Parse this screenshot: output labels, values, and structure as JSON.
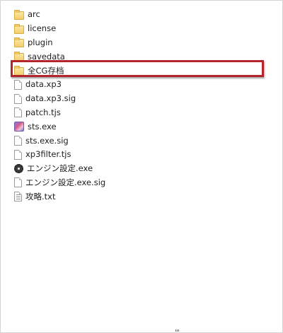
{
  "files": [
    {
      "name": "arc",
      "icon": "folder-icon"
    },
    {
      "name": "license",
      "icon": "folder-icon"
    },
    {
      "name": "plugin",
      "icon": "folder-icon"
    },
    {
      "name": "savedata",
      "icon": "folder-icon"
    },
    {
      "name": "全CG存档",
      "icon": "folder-icon",
      "highlighted": true
    },
    {
      "name": "data.xp3",
      "icon": "document-icon"
    },
    {
      "name": "data.xp3.sig",
      "icon": "document-icon"
    },
    {
      "name": "patch.tjs",
      "icon": "document-icon"
    },
    {
      "name": "sts.exe",
      "icon": "app-icon"
    },
    {
      "name": "sts.exe.sig",
      "icon": "document-icon"
    },
    {
      "name": "xp3filter.tjs",
      "icon": "document-icon"
    },
    {
      "name": "エンジン設定.exe",
      "icon": "gear-icon"
    },
    {
      "name": "エンジン設定.exe.sig",
      "icon": "document-icon"
    },
    {
      "name": "攻略.txt",
      "icon": "text-file-icon"
    }
  ],
  "colors": {
    "highlight_border": "#b3242b",
    "folder": "#f3cd6a",
    "text": "#1e1e1e"
  }
}
